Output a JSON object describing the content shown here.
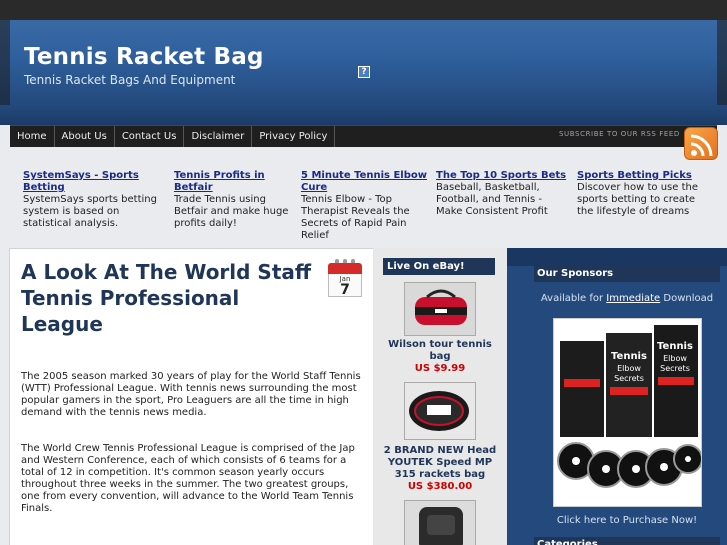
{
  "header": {
    "title": "Tennis Racket Bag",
    "tagline": "Tennis Racket Bags And Equipment",
    "help_icon": "?"
  },
  "nav": {
    "items": [
      "Home",
      "About Us",
      "Contact Us",
      "Disclaimer",
      "Privacy Policy"
    ],
    "rss_label": "SUBSCRIBE TO OUR RSS FEED"
  },
  "ads": [
    {
      "title": "SystemSays - Sports Betting",
      "desc": "SystemSays sports betting system is based on statistical analysis."
    },
    {
      "title": "Tennis Profits in Betfair",
      "desc": "Trade Tennis using Betfair and make huge profits daily!"
    },
    {
      "title": "5 Minute Tennis Elbow Cure",
      "desc": "Tennis Elbow - Top Therapist Reveals the Secrets of Rapid Pain Relief"
    },
    {
      "title": "The Top 10 Sports Bets",
      "desc": "Baseball, Basketball, Football, and Tennis - Make Consistent Profit"
    },
    {
      "title": "Sports Betting Picks",
      "desc": "Discover how to use the sports betting to create the lifestyle of dreams"
    }
  ],
  "post": {
    "title": "A Look At The World Staff Tennis Professional League",
    "calendar_month": "Jan",
    "calendar_day": "7",
    "paragraphs": [
      "The 2005 season marked 30 years of play for the World Staff Tennis (WTT) Professional League.  With tennis news surrounding the most popular gamers in the sport, Pro Leaguers are all the time in high demand with the tennis news media.",
      "The World Crew Tennis Professional League is comprised of the Jap and Western Conference, each of which consists of 6 teams for a total of 12 in competition.  It's common season yearly occurs throughout three weeks in the summer.  The two greatest groups, one from every convention, will advance to the World Team Tennis Finals."
    ]
  },
  "ebay": {
    "heading": "Live On eBay!",
    "items": [
      {
        "title": "Wilson tour tennis bag",
        "price": "US $9.99"
      },
      {
        "title": "2 BRAND NEW Head YOUTEK Speed MP 315 rackets bag",
        "price": "US $380.00"
      },
      {
        "title": "",
        "price": ""
      }
    ]
  },
  "sidebar": {
    "sponsors_heading": "Our Sponsors",
    "sponsor_text_pre": "Available for",
    "sponsor_text_link": "Immediate",
    "sponsor_text_post": "Download",
    "purchase_link": "Click here to Purchase Now!",
    "categories_heading": "Categories",
    "product_label": "Tennis Elbow Secrets"
  },
  "colors": {
    "header_blue": "#2f5f9c",
    "nav_dark": "#1f1f1f",
    "title_navy": "#1f3659",
    "price_red": "#cc0000",
    "ad_link": "#1a2a8a"
  }
}
